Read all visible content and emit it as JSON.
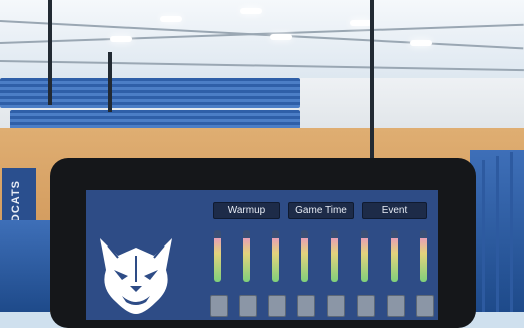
{
  "side_banner": {
    "text": "WILDCATS"
  },
  "panel": {
    "buttons": [
      {
        "label": "Warmup"
      },
      {
        "label": "Game Time"
      },
      {
        "label": "Event"
      }
    ],
    "channels": [
      {
        "level": 0.85
      },
      {
        "level": 0.85
      },
      {
        "level": 0.85
      },
      {
        "level": 0.85
      },
      {
        "level": 0.85
      },
      {
        "level": 0.85
      },
      {
        "level": 0.85
      },
      {
        "level": 0.85
      }
    ]
  },
  "colors": {
    "panel_bg": "#2e4c86",
    "button_bg": "#1d2b48",
    "tablet_bezel": "#15171a",
    "bleachers": "#2f5fa8",
    "floor": "#d9a468"
  }
}
